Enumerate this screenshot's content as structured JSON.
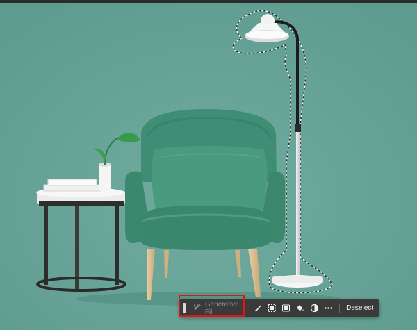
{
  "contextual_taskbar": {
    "generative_fill_label": "Generative Fill",
    "deselect_label": "Deselect",
    "tool_icons": [
      "generative-fill-icon",
      "brush-icon",
      "select-subject-icon",
      "mask-icon",
      "fill-bucket-icon",
      "adjustment-icon",
      "more-icon"
    ]
  },
  "colors": {
    "canvas_background": "#66a598",
    "chair": "#3e8a72",
    "toolbar": "#3a3a3a",
    "highlight_box": "#e01515"
  }
}
